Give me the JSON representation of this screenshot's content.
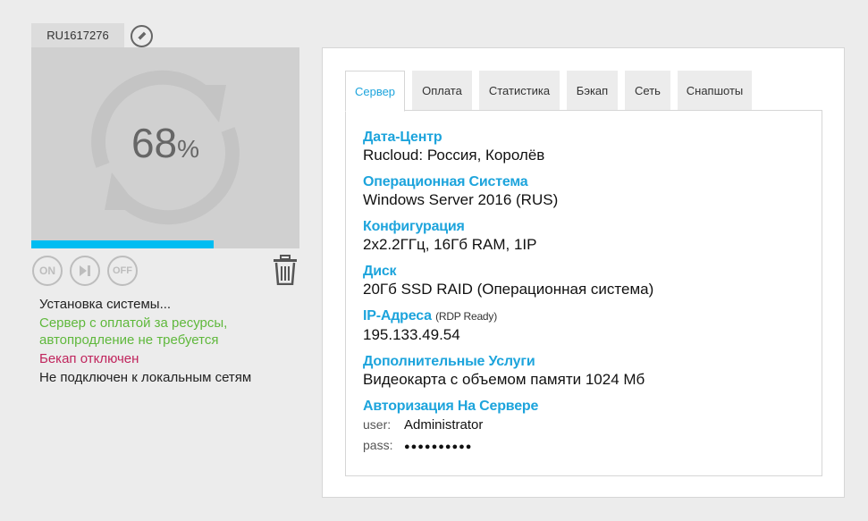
{
  "server": {
    "id": "RU1617276",
    "progress_number": "68",
    "progress_sign": "%",
    "progress_fraction": 0.68
  },
  "controls": {
    "on_label": "ON",
    "off_label": "OFF"
  },
  "status": {
    "install": "Установка системы...",
    "billing": "Сервер с оплатой за ресурсы, автопродление не требуется",
    "backup": "Бекап отключен",
    "network": "Не подключен к локальным сетям"
  },
  "tabs": [
    {
      "label": "Сервер",
      "active": true
    },
    {
      "label": "Оплата",
      "active": false
    },
    {
      "label": "Статистика",
      "active": false
    },
    {
      "label": "Бэкап",
      "active": false
    },
    {
      "label": "Сеть",
      "active": false
    },
    {
      "label": "Снапшоты",
      "active": false
    }
  ],
  "details": {
    "datacenter_label": "Дата-Центр",
    "datacenter_value": "Rucloud: Россия, Королёв",
    "os_label": "Операционная Система",
    "os_value": "Windows Server 2016 (RUS)",
    "config_label": "Конфигурация",
    "config_value": "2x2.2ГГц, 16Гб RAM, 1IP",
    "disk_label": "Диск",
    "disk_value": "20Гб SSD RAID (Операционная система)",
    "ip_label": "IP-Адреса",
    "ip_note": "(RDP Ready)",
    "ip_value": "195.133.49.54",
    "extra_label": "Дополнительные Услуги",
    "extra_value": "Видеокарта с объемом памяти 1024 Мб",
    "auth_label": "Авторизация На Сервере",
    "user_key": "user:",
    "user_value": "Administrator",
    "pass_key": "pass:",
    "pass_value": "●●●●●●●●●●"
  },
  "colors": {
    "accent": "#1da4dc",
    "progress": "#00bdf2",
    "ok_green": "#5fb83c",
    "warn_red": "#c0255d"
  },
  "icons": {
    "edit": "pencil-icon",
    "refresh": "refresh-icon",
    "play": "play-pause-icon",
    "trash": "trash-icon"
  }
}
